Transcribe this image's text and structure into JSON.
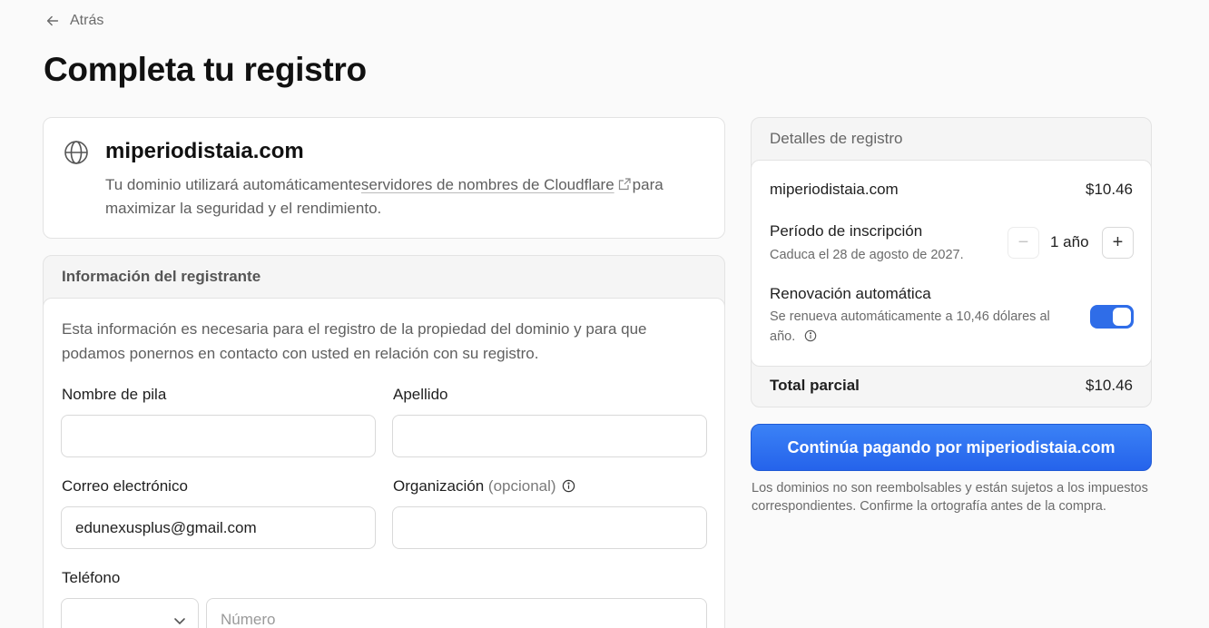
{
  "nav": {
    "back_label": "Atrás"
  },
  "page": {
    "title": "Completa tu registro"
  },
  "domain": {
    "name": "miperiodistaia.com",
    "desc_before": "Tu dominio utilizará automáticamente",
    "desc_link": "servidores de nombres de Cloudflare",
    "desc_after": "para maximizar la seguridad y el rendimiento."
  },
  "registrant": {
    "header": "Información del registrante",
    "intro": "Esta información es necesaria para el registro de la propiedad del dominio y para que podamos ponernos en contacto con usted en relación con su registro.",
    "first_name": {
      "label": "Nombre de pila",
      "value": ""
    },
    "last_name": {
      "label": "Apellido",
      "value": ""
    },
    "email": {
      "label": "Correo electrónico",
      "value": "edunexusplus@gmail.com"
    },
    "organization": {
      "label": "Organización",
      "optional": "(opcional)",
      "value": ""
    },
    "phone": {
      "label": "Teléfono",
      "country_value": "",
      "number_placeholder": "Número"
    }
  },
  "details": {
    "header": "Detalles de registro",
    "domain_name": "miperiodistaia.com",
    "domain_price": "$10.46",
    "period_label": "Período de inscripción",
    "period_expiry": "Caduca el 28 de agosto de 2027.",
    "period_value": "1 año",
    "minus": "−",
    "plus": "+",
    "renewal_label": "Renovación automática",
    "renewal_desc_1": "Se renueva automáticamente a 10,46 dólares al",
    "renewal_desc_2": "año.",
    "renewal_on": true,
    "subtotal_label": "Total parcial",
    "subtotal_value": "$10.46"
  },
  "cta": {
    "label": "Continúa pagando por miperiodistaia.com"
  },
  "disclaimer": "Los dominios no son reembolsables y están sujetos a los impuestos correspondientes. Confirme la ortografía antes de la compra.",
  "colors": {
    "accent": "#2f6de8",
    "button": "#2563eb"
  }
}
